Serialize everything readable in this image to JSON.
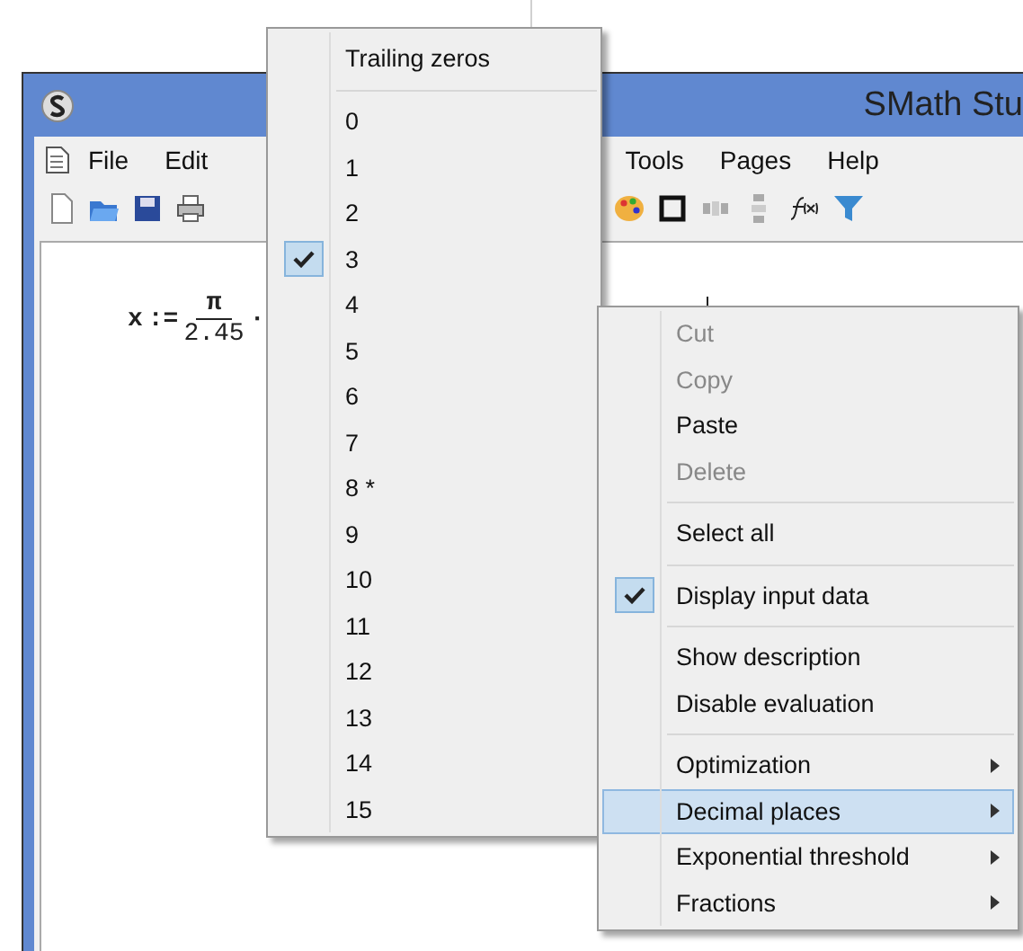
{
  "window": {
    "title": "SMath Stu",
    "menu": [
      "File",
      "Edit",
      "Tools",
      "Pages",
      "Help"
    ]
  },
  "worksheet": {
    "expression": {
      "variable": "x",
      "operator": ":=",
      "numerator": "π",
      "denominator": "2.45",
      "trailing": "·"
    }
  },
  "decimal_submenu": {
    "header": "Trailing zeros",
    "items": [
      {
        "label": "0",
        "checked": false
      },
      {
        "label": "1",
        "checked": false
      },
      {
        "label": "2",
        "checked": false
      },
      {
        "label": "3",
        "checked": true
      },
      {
        "label": "4",
        "checked": false
      },
      {
        "label": "5",
        "checked": false
      },
      {
        "label": "6",
        "checked": false
      },
      {
        "label": "7",
        "checked": false
      },
      {
        "label": "8 *",
        "checked": false
      },
      {
        "label": "9",
        "checked": false
      },
      {
        "label": "10",
        "checked": false
      },
      {
        "label": "11",
        "checked": false
      },
      {
        "label": "12",
        "checked": false
      },
      {
        "label": "13",
        "checked": false
      },
      {
        "label": "14",
        "checked": false
      },
      {
        "label": "15",
        "checked": false
      }
    ]
  },
  "context_menu": {
    "items": [
      {
        "kind": "item",
        "label": "Cut",
        "disabled": true,
        "checked": false,
        "submenu": false,
        "selected": false
      },
      {
        "kind": "item",
        "label": "Copy",
        "disabled": true,
        "checked": false,
        "submenu": false,
        "selected": false
      },
      {
        "kind": "item",
        "label": "Paste",
        "disabled": false,
        "checked": false,
        "submenu": false,
        "selected": false
      },
      {
        "kind": "item",
        "label": "Delete",
        "disabled": true,
        "checked": false,
        "submenu": false,
        "selected": false
      },
      {
        "kind": "separator"
      },
      {
        "kind": "item",
        "label": "Select all",
        "disabled": false,
        "checked": false,
        "submenu": false,
        "selected": false
      },
      {
        "kind": "separator"
      },
      {
        "kind": "item",
        "label": "Display input data",
        "disabled": false,
        "checked": true,
        "submenu": false,
        "selected": false
      },
      {
        "kind": "separator"
      },
      {
        "kind": "item",
        "label": "Show description",
        "disabled": false,
        "checked": false,
        "submenu": false,
        "selected": false
      },
      {
        "kind": "item",
        "label": "Disable evaluation",
        "disabled": false,
        "checked": false,
        "submenu": false,
        "selected": false
      },
      {
        "kind": "separator"
      },
      {
        "kind": "item",
        "label": "Optimization",
        "disabled": false,
        "checked": false,
        "submenu": true,
        "selected": false
      },
      {
        "kind": "item",
        "label": "Decimal places",
        "disabled": false,
        "checked": false,
        "submenu": true,
        "selected": true
      },
      {
        "kind": "item",
        "label": "Exponential threshold",
        "disabled": false,
        "checked": false,
        "submenu": true,
        "selected": false
      },
      {
        "kind": "item",
        "label": "Fractions",
        "disabled": false,
        "checked": false,
        "submenu": true,
        "selected": false
      }
    ]
  }
}
